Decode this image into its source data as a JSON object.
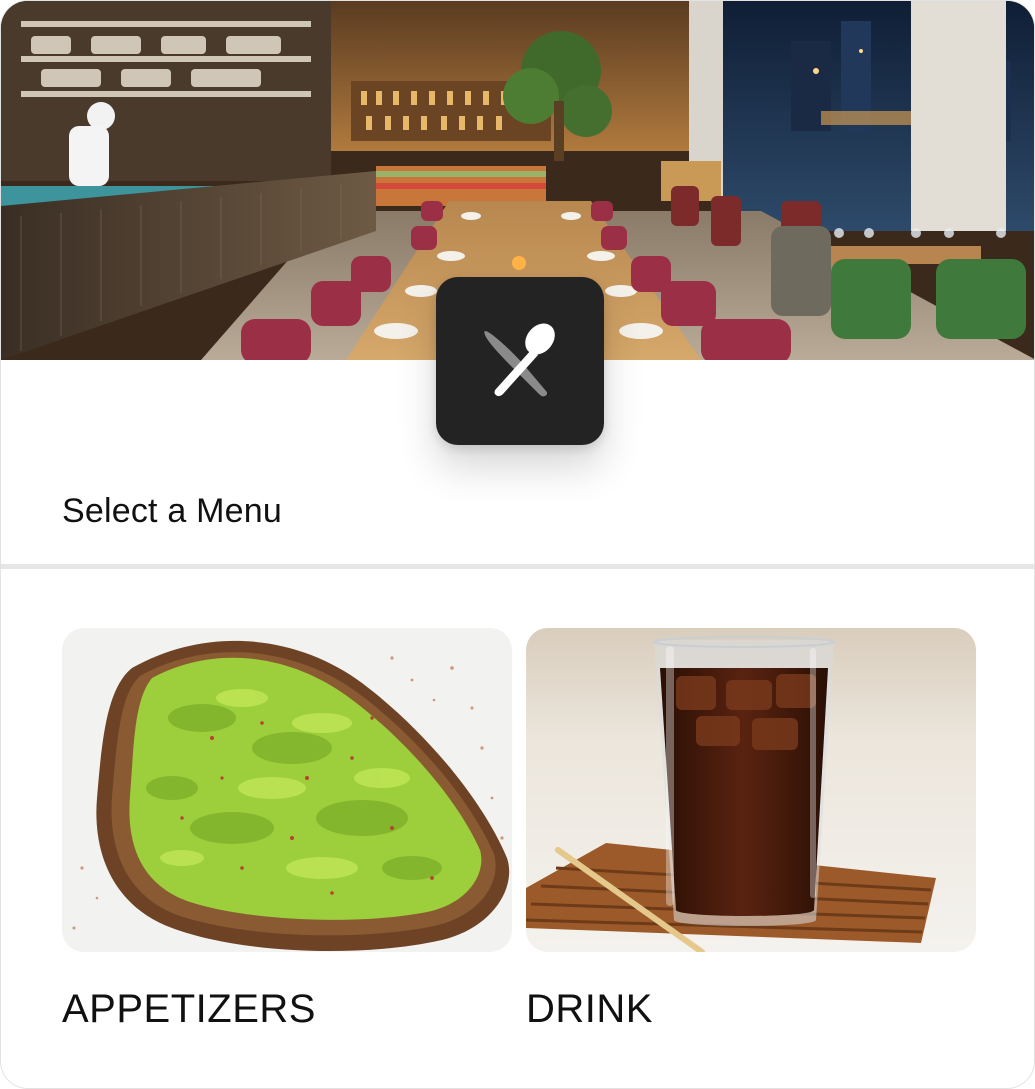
{
  "hero": {
    "icon": "restaurant-interior-photo"
  },
  "badge": {
    "icon": "knife-spoon-icon"
  },
  "heading": "Select a Menu",
  "menus": [
    {
      "label": "APPETIZERS",
      "icon": "avocado-toast-photo"
    },
    {
      "label": "DRINK",
      "icon": "iced-drink-photo"
    }
  ],
  "colors": {
    "badge_bg": "#232323",
    "avocado": "#9ccf3b",
    "drink": "#3a1608",
    "text": "#111111"
  }
}
